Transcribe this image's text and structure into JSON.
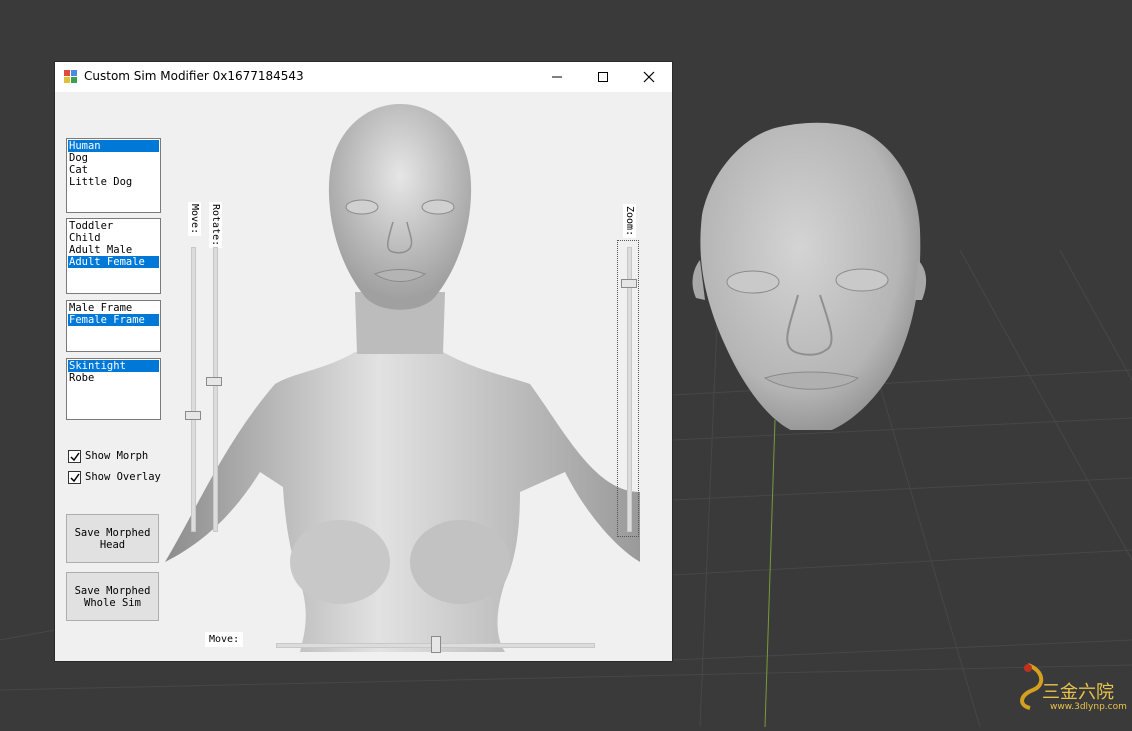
{
  "window": {
    "title": "Custom Sim Modifier 0x1677184543"
  },
  "species_list": {
    "items": [
      "Human",
      "Dog",
      "Cat",
      "Little Dog"
    ],
    "selected": "Human"
  },
  "age_list": {
    "items": [
      "Toddler",
      "Child",
      "Adult Male",
      "Adult Female"
    ],
    "selected": "Adult Female"
  },
  "frame_list": {
    "items": [
      "Male Frame",
      "Female Frame"
    ],
    "selected": "Female Frame"
  },
  "clothing_list": {
    "items": [
      "Skintight",
      "Robe"
    ],
    "selected": "Skintight"
  },
  "options": {
    "show_morph": "Show Morph",
    "show_overlay": "Show Overlay",
    "show_morph_checked": true,
    "show_overlay_checked": true
  },
  "buttons": {
    "save_head": "Save Morphed\nHead",
    "save_sim": "Save Morphed\nWhole Sim"
  },
  "sliders": {
    "move_v_label": "Move:",
    "move_v_value": 0.55,
    "rotate_label": "Rotate:",
    "rotate_value": 0.45,
    "zoom_label": "Zoom:",
    "zoom_value": 0.12,
    "move_h_label": "Move:",
    "move_h_value": 0.5
  },
  "watermark": {
    "text": "三金六院",
    "url": "www.3dlynp.com"
  },
  "colors": {
    "selection": "#0078d7",
    "viewport_bg": "#3a3a3a",
    "window_bg": "#f0f0f0"
  }
}
